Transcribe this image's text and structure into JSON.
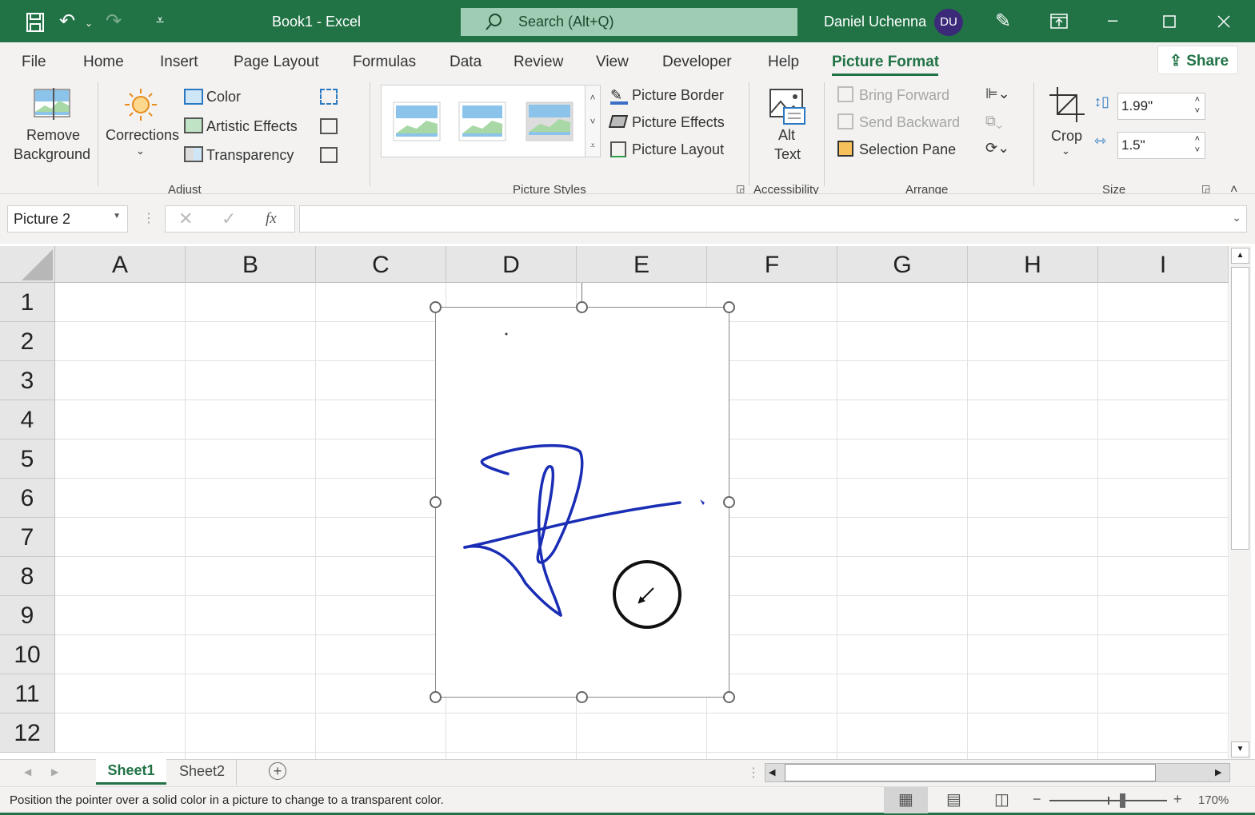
{
  "titlebar": {
    "doc_title": "Book1  -  Excel",
    "search_placeholder": "Search (Alt+Q)",
    "user_name": "Daniel Uchenna",
    "user_initials": "DU"
  },
  "tabs": [
    "File",
    "Home",
    "Insert",
    "Page Layout",
    "Formulas",
    "Data",
    "Review",
    "View",
    "Developer",
    "Help",
    "Picture Format"
  ],
  "active_tab": "Picture Format",
  "share_label": "Share",
  "ribbon": {
    "remove_bg": [
      "Remove",
      "Background"
    ],
    "corrections": "Corrections",
    "color": "Color",
    "artistic_effects": "Artistic Effects",
    "transparency": "Transparency",
    "adjust_group": "Adjust",
    "picture_border": "Picture Border",
    "picture_effects": "Picture Effects",
    "picture_layout": "Picture Layout",
    "styles_group": "Picture Styles",
    "alt_text": [
      "Alt",
      "Text"
    ],
    "accessibility_group": "Accessibility",
    "bring_forward": "Bring Forward",
    "send_backward": "Send Backward",
    "selection_pane": "Selection Pane",
    "arrange_group": "Arrange",
    "crop": "Crop",
    "height": "1.99\"",
    "width": "1.5\"",
    "size_group": "Size"
  },
  "formula_bar": {
    "name_box": "Picture 2",
    "fx": "fx",
    "value": ""
  },
  "grid": {
    "columns": [
      "A",
      "B",
      "C",
      "D",
      "E",
      "F",
      "G",
      "H",
      "I"
    ],
    "rows": [
      "1",
      "2",
      "3",
      "4",
      "5",
      "6",
      "7",
      "8",
      "9",
      "10",
      "11",
      "12"
    ]
  },
  "sheets": [
    "Sheet1",
    "Sheet2"
  ],
  "active_sheet": "Sheet1",
  "status": {
    "message": "Position the pointer over a solid color in a picture to change to a transparent color.",
    "zoom": "170%",
    "zoom_percent": 170
  },
  "colors": {
    "brand": "#217346",
    "ink": "#1a2db5"
  }
}
